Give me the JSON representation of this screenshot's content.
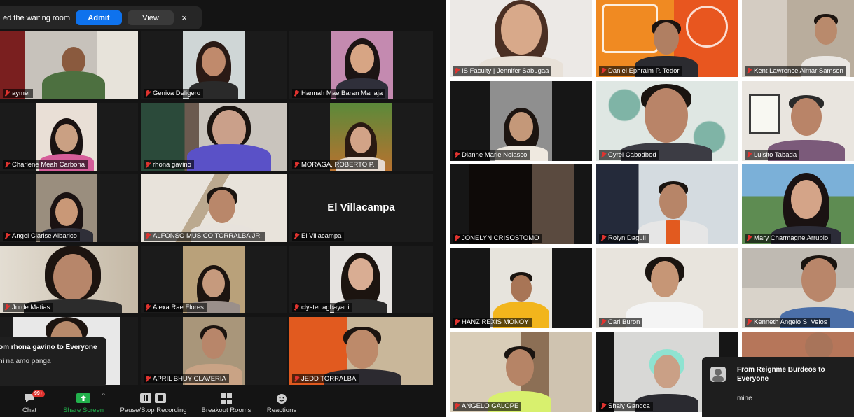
{
  "left_panel": {
    "waiting_bar": {
      "text": "ed the waiting room",
      "admit_label": "Admit",
      "view_label": "View",
      "close_label": "×"
    },
    "tiles": [
      {
        "name": "aymer"
      },
      {
        "name": "Geniva Deligero"
      },
      {
        "name": "Hannah Mae Baran Mariaja"
      },
      {
        "name": "Charlene Meah Carbona"
      },
      {
        "name": "rhona gavino"
      },
      {
        "name": "MORAGA, ROBERTO P."
      },
      {
        "name": "Angel Clarise Albarico"
      },
      {
        "name": "ALFONSO MUSICO TORRALBA JR."
      },
      {
        "name": "El Villacampa",
        "display_name": "El Villacampa"
      },
      {
        "name": "Jurde Matias"
      },
      {
        "name": "Alexa Rae Flores"
      },
      {
        "name": "clyster agbayani"
      },
      {
        "name": ""
      },
      {
        "name": "APRIL BHUY CLAVERIA"
      },
      {
        "name": "JEDD TORRALBA"
      }
    ],
    "chat_popup": {
      "from": "om rhona gavino to Everyone",
      "message": "ni na amo panga"
    },
    "toolbar": {
      "chat_label": "Chat",
      "chat_badge": "99+",
      "share_label": "Share Screen",
      "record_label": "Pause/Stop Recording",
      "breakout_label": "Breakout Rooms",
      "reactions_label": "Reactions"
    }
  },
  "right_panel": {
    "tiles": [
      {
        "name": "IS Faculty | Jennifer Sabugaa"
      },
      {
        "name": "Daniel Ephraim P. Tedor"
      },
      {
        "name": "Kent Lawrence Almar Samson"
      },
      {
        "name": "Dianne Marie Nolasco"
      },
      {
        "name": "Cyrel Cabodbod"
      },
      {
        "name": "Luisito Tabada"
      },
      {
        "name": "JONELYN CRISOSTOMO"
      },
      {
        "name": "Rolyn Daguil"
      },
      {
        "name": "Mary Charmagne Arrubio"
      },
      {
        "name": "HANZ REXIS MONOY"
      },
      {
        "name": "Carl Buron"
      },
      {
        "name": "Kenneth Angelo S. Velos"
      },
      {
        "name": "ANGELO GALOPE"
      },
      {
        "name": "Shaly Gangca"
      },
      {
        "name": ""
      }
    ],
    "chat_popup": {
      "from": "From Reignme Burdeos to Everyone",
      "message": "mine"
    }
  },
  "colors": {
    "accent": "#0e72ed",
    "muted_mic": "#e0332f",
    "share_green": "#22b14c",
    "badge_red": "#e0332f"
  }
}
